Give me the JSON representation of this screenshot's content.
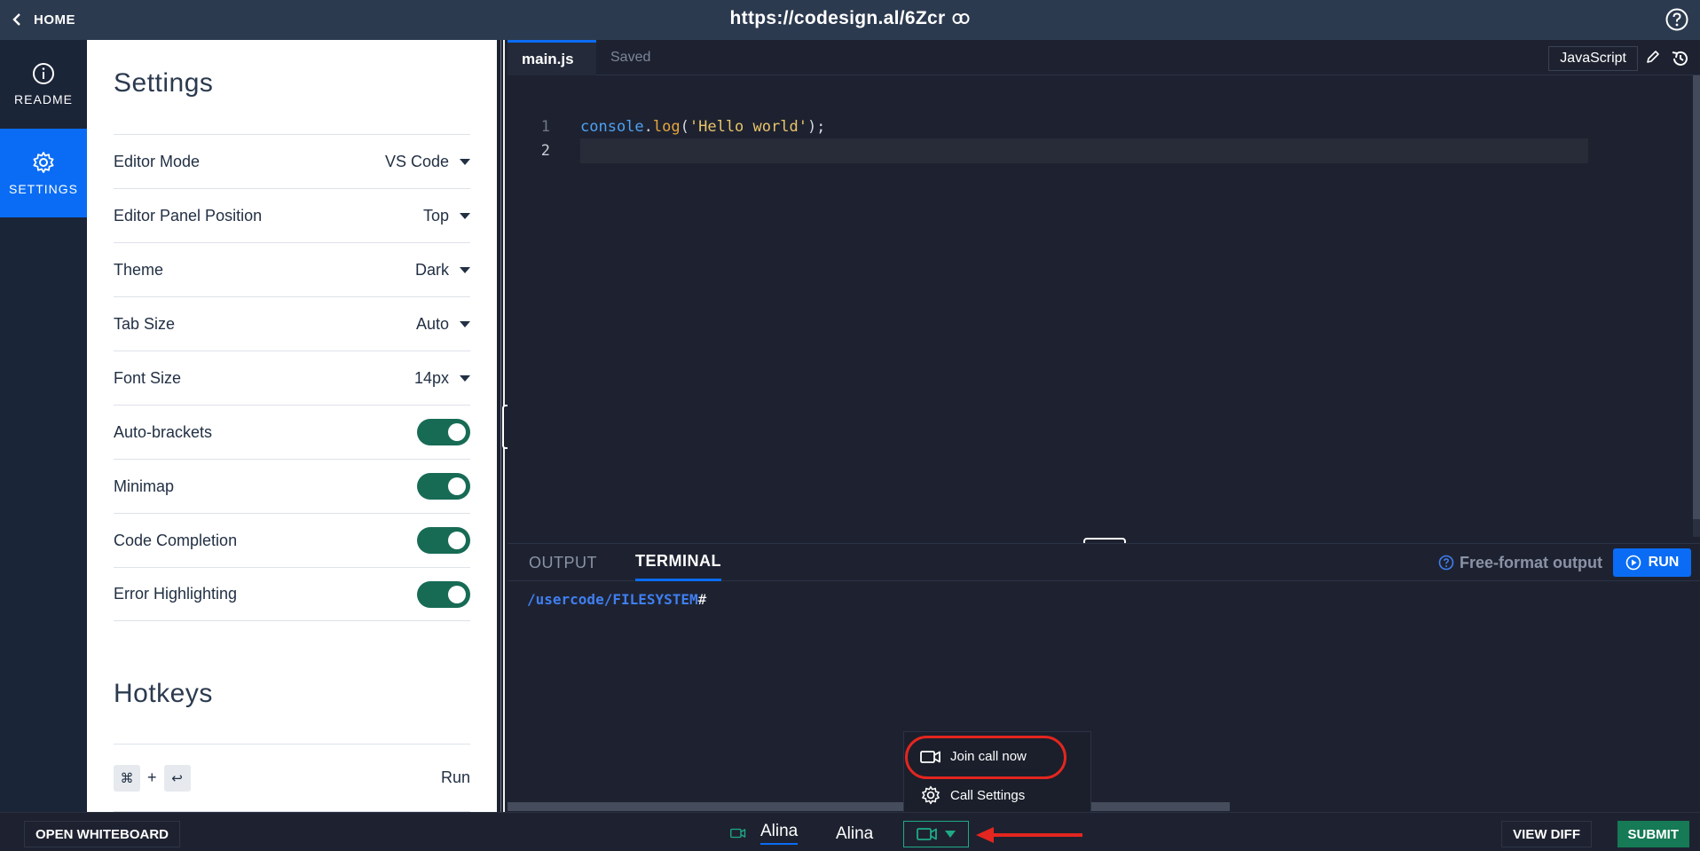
{
  "topbar": {
    "home_label": "HOME",
    "url": "https://codesign.al/6Zcr"
  },
  "sidenav": {
    "items": [
      {
        "label": "README",
        "icon": "info-icon"
      },
      {
        "label": "SETTINGS",
        "icon": "gear-icon",
        "active": true
      }
    ]
  },
  "settings": {
    "title": "Settings",
    "rows": [
      {
        "label": "Editor Mode",
        "value": "VS Code"
      },
      {
        "label": "Editor Panel Position",
        "value": "Top"
      },
      {
        "label": "Theme",
        "value": "Dark"
      },
      {
        "label": "Tab Size",
        "value": "Auto"
      },
      {
        "label": "Font Size",
        "value": "14px"
      },
      {
        "label": "Auto-brackets",
        "enabled": true
      },
      {
        "label": "Minimap",
        "enabled": true
      },
      {
        "label": "Code Completion",
        "enabled": true
      },
      {
        "label": "Error Highlighting",
        "enabled": true
      }
    ],
    "hotkeys": {
      "title": "Hotkeys",
      "key1": "⌘",
      "plus": "+",
      "key2": "↩",
      "action": "Run"
    }
  },
  "editor": {
    "filename": "main.js",
    "status": "Saved",
    "language": "JavaScript",
    "lines": [
      {
        "number": "1",
        "obj": "console",
        "dot": ".",
        "fn": "log",
        "open": "(",
        "str": "'Hello world'",
        "close": ");"
      },
      {
        "number": "2"
      }
    ]
  },
  "output": {
    "tabs": [
      "OUTPUT",
      "TERMINAL"
    ],
    "active_tab": "TERMINAL",
    "format_label": "Free-format output",
    "run_label": "RUN",
    "prompt_path": "/usercode/FILESYSTEM",
    "prompt_symbol": "#"
  },
  "bottombar": {
    "whiteboard_label": "OPEN WHITEBOARD",
    "participants": [
      "Alina",
      "Alina"
    ],
    "view_diff_label": "VIEW DIFF",
    "submit_label": "SUBMIT"
  },
  "call_menu": {
    "join_label": "Join call now",
    "settings_label": "Call Settings"
  },
  "colors": {
    "accent": "#0a6cf5",
    "toggle_on": "#176b55",
    "submit": "#157a55",
    "call": "#1faa86",
    "annotation": "#e3261f"
  }
}
